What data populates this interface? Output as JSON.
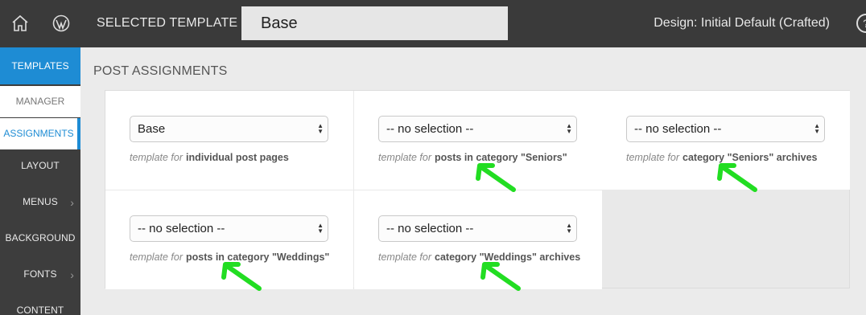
{
  "topbar": {
    "selected_label": "SELECTED TEMPLATE",
    "template_value": "Base",
    "design_label": "Design: Initial Default (Crafted)",
    "help_glyph": "?"
  },
  "sidebar": {
    "templates": "TEMPLATES",
    "manager": "MANAGER",
    "assignments": "ASSIGNMENTS",
    "layout": "LAYOUT",
    "menus": "MENUS",
    "background": "BACKGROUND",
    "fonts": "FONTS",
    "content": "CONTENT",
    "chevron": "›"
  },
  "main": {
    "title": "POST ASSIGNMENTS",
    "prefix": "template for",
    "cells": [
      {
        "value": "Base",
        "desc": "individual post pages"
      },
      {
        "value": "-- no selection --",
        "desc": "posts in category \"Seniors\""
      },
      {
        "value": "-- no selection --",
        "desc": "category \"Seniors\" archives"
      },
      {
        "value": "-- no selection --",
        "desc": "posts in category \"Weddings\""
      },
      {
        "value": "-- no selection --",
        "desc": "category \"Weddings\" archives"
      }
    ]
  },
  "colors": {
    "accent": "#1e8cd4",
    "topbar": "#3a3a3a",
    "arrow": "#22dd22"
  }
}
